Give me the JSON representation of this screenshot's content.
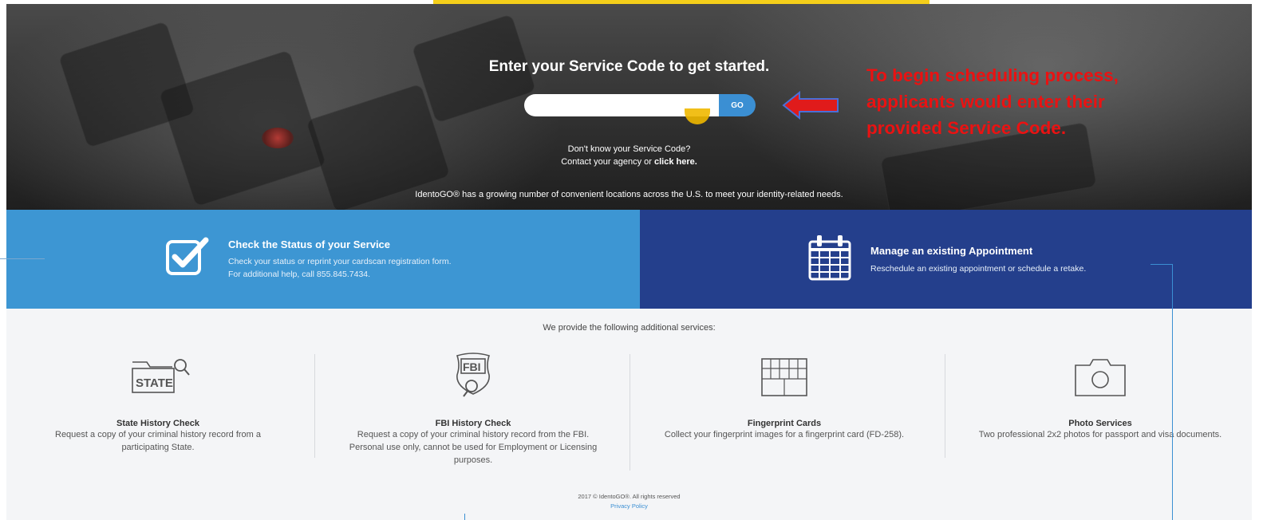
{
  "hero": {
    "title": "Enter your Service Code to get started.",
    "search": {
      "value": "",
      "placeholder": ""
    },
    "go_label": "GO",
    "help_line1": "Don't know your Service Code?",
    "help_line2_prefix": "Contact your agency or ",
    "help_link": "click here.",
    "tagline": "IdentoGO® has a growing number of convenient locations across the U.S. to meet your identity-related needs."
  },
  "annotation": {
    "lines": [
      "To begin scheduling process,",
      "applicants would enter their",
      "provided Service Code."
    ],
    "color": "#ea1212"
  },
  "status_panel": {
    "title": "Check the Status of your Service",
    "desc_line1": "Check your status or reprint your cardscan registration form.",
    "desc_line2": "For additional help, call 855.845.7434.",
    "icon": "checkbox-check-icon",
    "color": "#3d96d3"
  },
  "appointment_panel": {
    "title": "Manage an existing Appointment",
    "desc": "Reschedule an existing appointment or schedule a retake.",
    "icon": "calendar-icon",
    "color": "#243f8c"
  },
  "services": {
    "heading": "We provide the following additional services:",
    "items": [
      {
        "title": "State History Check",
        "desc": "Request a copy of your criminal history record from a participating State.",
        "icon": "state-folder-search-icon",
        "icon_text": "STATE"
      },
      {
        "title": "FBI History Check",
        "desc": "Request a copy of your criminal history record from the FBI. Personal use only, cannot be used for Employment or Licensing purposes.",
        "icon": "fbi-badge-search-icon",
        "icon_text": "FBI"
      },
      {
        "title": "Fingerprint Cards",
        "desc": "Collect your fingerprint images for a fingerprint card (FD-258).",
        "icon": "fingerprint-card-icon"
      },
      {
        "title": "Photo Services",
        "desc": "Two professional 2x2 photos for passport and visa documents.",
        "icon": "camera-icon"
      }
    ]
  },
  "footer": {
    "copyright": "2017 © IdentoGO®. All rights reserved",
    "privacy": "Privacy Policy"
  }
}
